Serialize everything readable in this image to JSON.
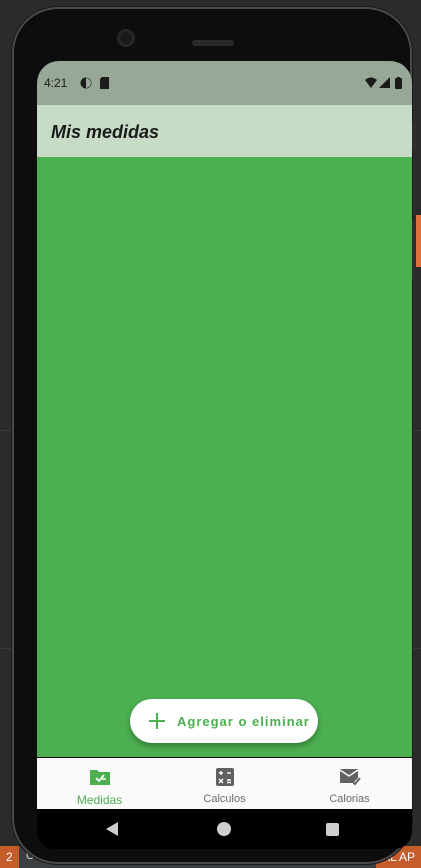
{
  "ide": {
    "bottom_left_tag": "2",
    "bottom_left_text": "C",
    "bottom_right_text": "AL AP"
  },
  "statusbar": {
    "time": "4:21"
  },
  "appbar": {
    "title": "Mis medidas"
  },
  "fab": {
    "label": "Agregar o eliminar",
    "icon": "plus-icon"
  },
  "bottom_nav": {
    "items": [
      {
        "label": "Medidas",
        "icon": "folder-ruler-icon",
        "active": true
      },
      {
        "label": "Calculos",
        "icon": "calculator-icon",
        "active": false
      },
      {
        "label": "Calorias",
        "icon": "mail-check-icon",
        "active": false
      }
    ]
  },
  "colors": {
    "primary": "#4caf50",
    "appbar": "#c6dcc7",
    "statusbar": "#98a898"
  }
}
